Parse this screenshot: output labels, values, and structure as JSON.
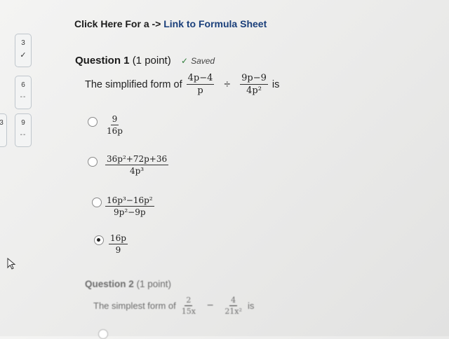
{
  "header": {
    "prefix": "Click Here For a -> ",
    "link_label": "Link to Formula Sheet"
  },
  "nav": [
    {
      "number": "3",
      "status": "✓"
    },
    {
      "number": "6",
      "status": "--"
    },
    {
      "number": "9",
      "status": "--"
    }
  ],
  "nav_partial": "3",
  "question1": {
    "title": "Question 1",
    "points": "(1 point)",
    "saved": "Saved",
    "stem_prefix": "The simplified form of",
    "frac1": {
      "num": "4p−4",
      "den": "p"
    },
    "op": "÷",
    "frac2": {
      "num": "9p−9",
      "den": "4p²"
    },
    "stem_suffix": "is",
    "options": [
      {
        "num": "9",
        "den": "16p",
        "selected": false
      },
      {
        "num": "36p²+72p+36",
        "den": "4p³",
        "selected": false
      },
      {
        "num": "16p³−16p²",
        "den": "9p²−9p",
        "selected": false
      },
      {
        "num": "16p",
        "den": "9",
        "selected": true
      }
    ]
  },
  "question2": {
    "title": "Question 2",
    "points": "(1 point)",
    "stem_prefix": "The simplest form of",
    "frac1": {
      "num": "2",
      "den": "15x"
    },
    "op": "−",
    "frac2": {
      "num": "4",
      "den": "21x²"
    },
    "stem_suffix": "is"
  }
}
